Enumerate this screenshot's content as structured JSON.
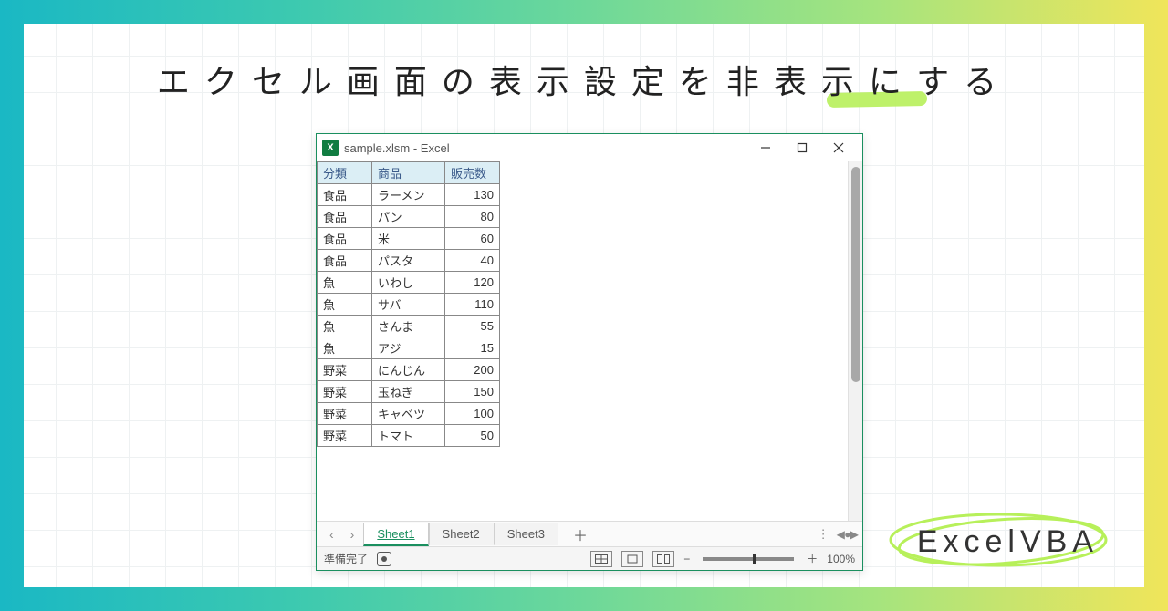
{
  "headline": "エクセル画面の表示設定を非表示にする",
  "brand": "ExcelVBA",
  "window": {
    "title": "sample.xlsm - Excel",
    "excel_icon_label": "X"
  },
  "table": {
    "headers": [
      "分類",
      "商品",
      "販売数"
    ],
    "rows": [
      [
        "食品",
        "ラーメン",
        "130"
      ],
      [
        "食品",
        "パン",
        "80"
      ],
      [
        "食品",
        "米",
        "60"
      ],
      [
        "食品",
        "パスタ",
        "40"
      ],
      [
        "魚",
        "いわし",
        "120"
      ],
      [
        "魚",
        "サバ",
        "110"
      ],
      [
        "魚",
        "さんま",
        "55"
      ],
      [
        "魚",
        "アジ",
        "15"
      ],
      [
        "野菜",
        "にんじん",
        "200"
      ],
      [
        "野菜",
        "玉ねぎ",
        "150"
      ],
      [
        "野菜",
        "キャベツ",
        "100"
      ],
      [
        "野菜",
        "トマト",
        "50"
      ]
    ]
  },
  "tabs": {
    "prev": "‹",
    "next": "›",
    "items": [
      "Sheet1",
      "Sheet2",
      "Sheet3"
    ],
    "active_index": 0,
    "add": "＋",
    "dots": "⋮",
    "hnav": "◀ ● ▶"
  },
  "status": {
    "ready": "準備完了",
    "zoom_minus": "−",
    "zoom_plus": "＋",
    "zoom_pct": "100%"
  },
  "chart_data": {
    "type": "table",
    "columns": [
      "分類",
      "商品",
      "販売数"
    ],
    "rows": [
      {
        "分類": "食品",
        "商品": "ラーメン",
        "販売数": 130
      },
      {
        "分類": "食品",
        "商品": "パン",
        "販売数": 80
      },
      {
        "分類": "食品",
        "商品": "米",
        "販売数": 60
      },
      {
        "分類": "食品",
        "商品": "パスタ",
        "販売数": 40
      },
      {
        "分類": "魚",
        "商品": "いわし",
        "販売数": 120
      },
      {
        "分類": "魚",
        "商品": "サバ",
        "販売数": 110
      },
      {
        "分類": "魚",
        "商品": "さんま",
        "販売数": 55
      },
      {
        "分類": "魚",
        "商品": "アジ",
        "販売数": 15
      },
      {
        "分類": "野菜",
        "商品": "にんじん",
        "販売数": 200
      },
      {
        "分類": "野菜",
        "商品": "玉ねぎ",
        "販売数": 150
      },
      {
        "分類": "野菜",
        "商品": "キャベツ",
        "販売数": 100
      },
      {
        "分類": "野菜",
        "商品": "トマト",
        "販売数": 50
      }
    ]
  }
}
